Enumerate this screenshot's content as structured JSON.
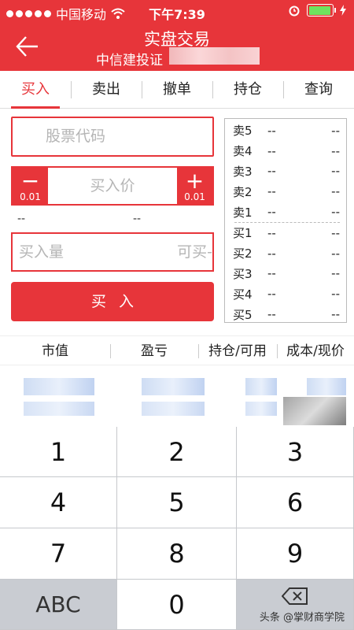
{
  "status_bar": {
    "carrier": "中国移动",
    "wifi_icon": "wifi-icon",
    "time": "下午7:39",
    "alarm_icon": "alarm-icon",
    "battery_level": 0.95
  },
  "header": {
    "title": "实盘交易",
    "subtitle": "中信建投证",
    "back_icon": "arrow-left-icon"
  },
  "tabs": [
    "买入",
    "卖出",
    "撤单",
    "持仓",
    "查询"
  ],
  "active_tab": "买入",
  "form": {
    "code_placeholder": "股票代码",
    "price_placeholder": "买入价",
    "minus_symbol": "−",
    "plus_symbol": "+",
    "step": "0.01",
    "lower_limit": "--",
    "upper_limit": "--",
    "qty_placeholder": "买入量",
    "available_label": "可买-",
    "buy_button": "买入"
  },
  "orderbook": {
    "asks": [
      {
        "label": "卖5",
        "price": "--",
        "volume": "--"
      },
      {
        "label": "卖4",
        "price": "--",
        "volume": "--"
      },
      {
        "label": "卖3",
        "price": "--",
        "volume": "--"
      },
      {
        "label": "卖2",
        "price": "--",
        "volume": "--"
      },
      {
        "label": "卖1",
        "price": "--",
        "volume": "--"
      }
    ],
    "bids": [
      {
        "label": "买1",
        "price": "--",
        "volume": "--"
      },
      {
        "label": "买2",
        "price": "--",
        "volume": "--"
      },
      {
        "label": "买3",
        "price": "--",
        "volume": "--"
      },
      {
        "label": "买4",
        "price": "--",
        "volume": "--"
      },
      {
        "label": "买5",
        "price": "--",
        "volume": "--"
      }
    ]
  },
  "positions": {
    "columns": [
      "市值",
      "盈亏",
      "持仓/可用",
      "成本/现价"
    ]
  },
  "keypad": {
    "keys": [
      "1",
      "2",
      "3",
      "4",
      "5",
      "6",
      "7",
      "8",
      "9",
      "ABC",
      "0"
    ],
    "delete_icon": "backspace-icon"
  },
  "watermark": "头条 @掌财商学院",
  "colors": {
    "accent": "#e7353a",
    "placeholder": "#b5b5b5",
    "keypad_bg": "#d2d5db"
  }
}
